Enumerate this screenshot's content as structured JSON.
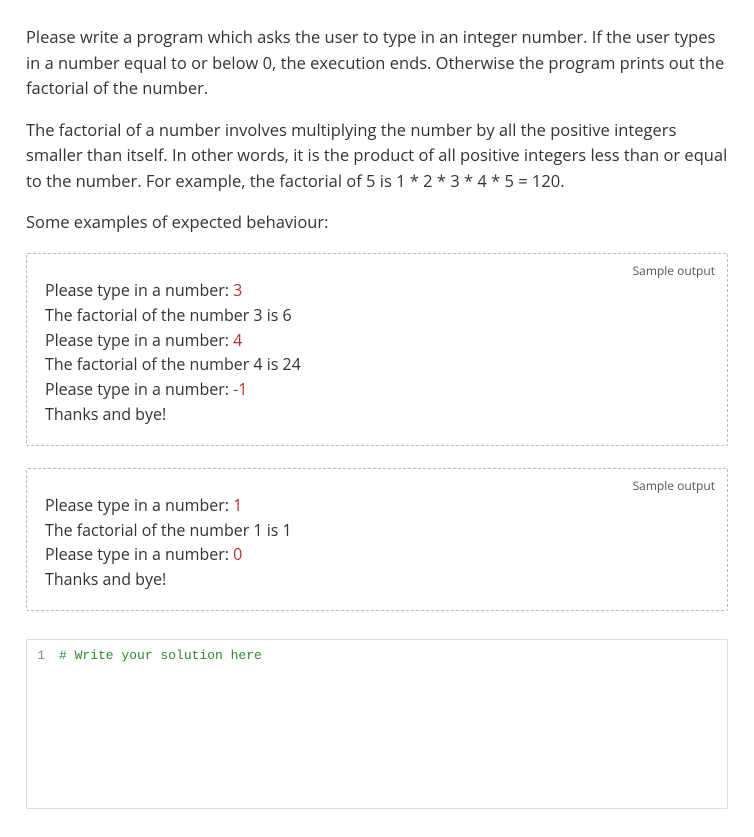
{
  "paragraphs": [
    "Please write a program which asks the user to type in an integer number. If the user types in a number equal to or below 0, the execution ends. Otherwise the program prints out the factorial of the number.",
    "The factorial of a number involves multiplying the number by all the positive integers smaller than itself. In other words, it is the product of all positive integers less than or equal to the number. For example, the factorial of 5 is 1 * 2 * 3 * 4 * 5 = 120.",
    "Some examples of expected behaviour:"
  ],
  "sample_label": "Sample output",
  "samples": [
    {
      "lines": [
        {
          "prompt": "Please type in a number: ",
          "input": "3"
        },
        {
          "prompt": "The factorial of the number 3 is 6",
          "input": ""
        },
        {
          "prompt": "Please type in a number: ",
          "input": "4"
        },
        {
          "prompt": "The factorial of the number 4 is 24",
          "input": ""
        },
        {
          "prompt": "Please type in a number: ",
          "input": "-1"
        },
        {
          "prompt": "Thanks and bye!",
          "input": ""
        }
      ]
    },
    {
      "lines": [
        {
          "prompt": "Please type in a number: ",
          "input": "1"
        },
        {
          "prompt": "The factorial of the number 1 is 1",
          "input": ""
        },
        {
          "prompt": "Please type in a number: ",
          "input": "0"
        },
        {
          "prompt": "Thanks and bye!",
          "input": ""
        }
      ]
    }
  ],
  "editor": {
    "line_number": "1",
    "code": "# Write your solution here"
  }
}
